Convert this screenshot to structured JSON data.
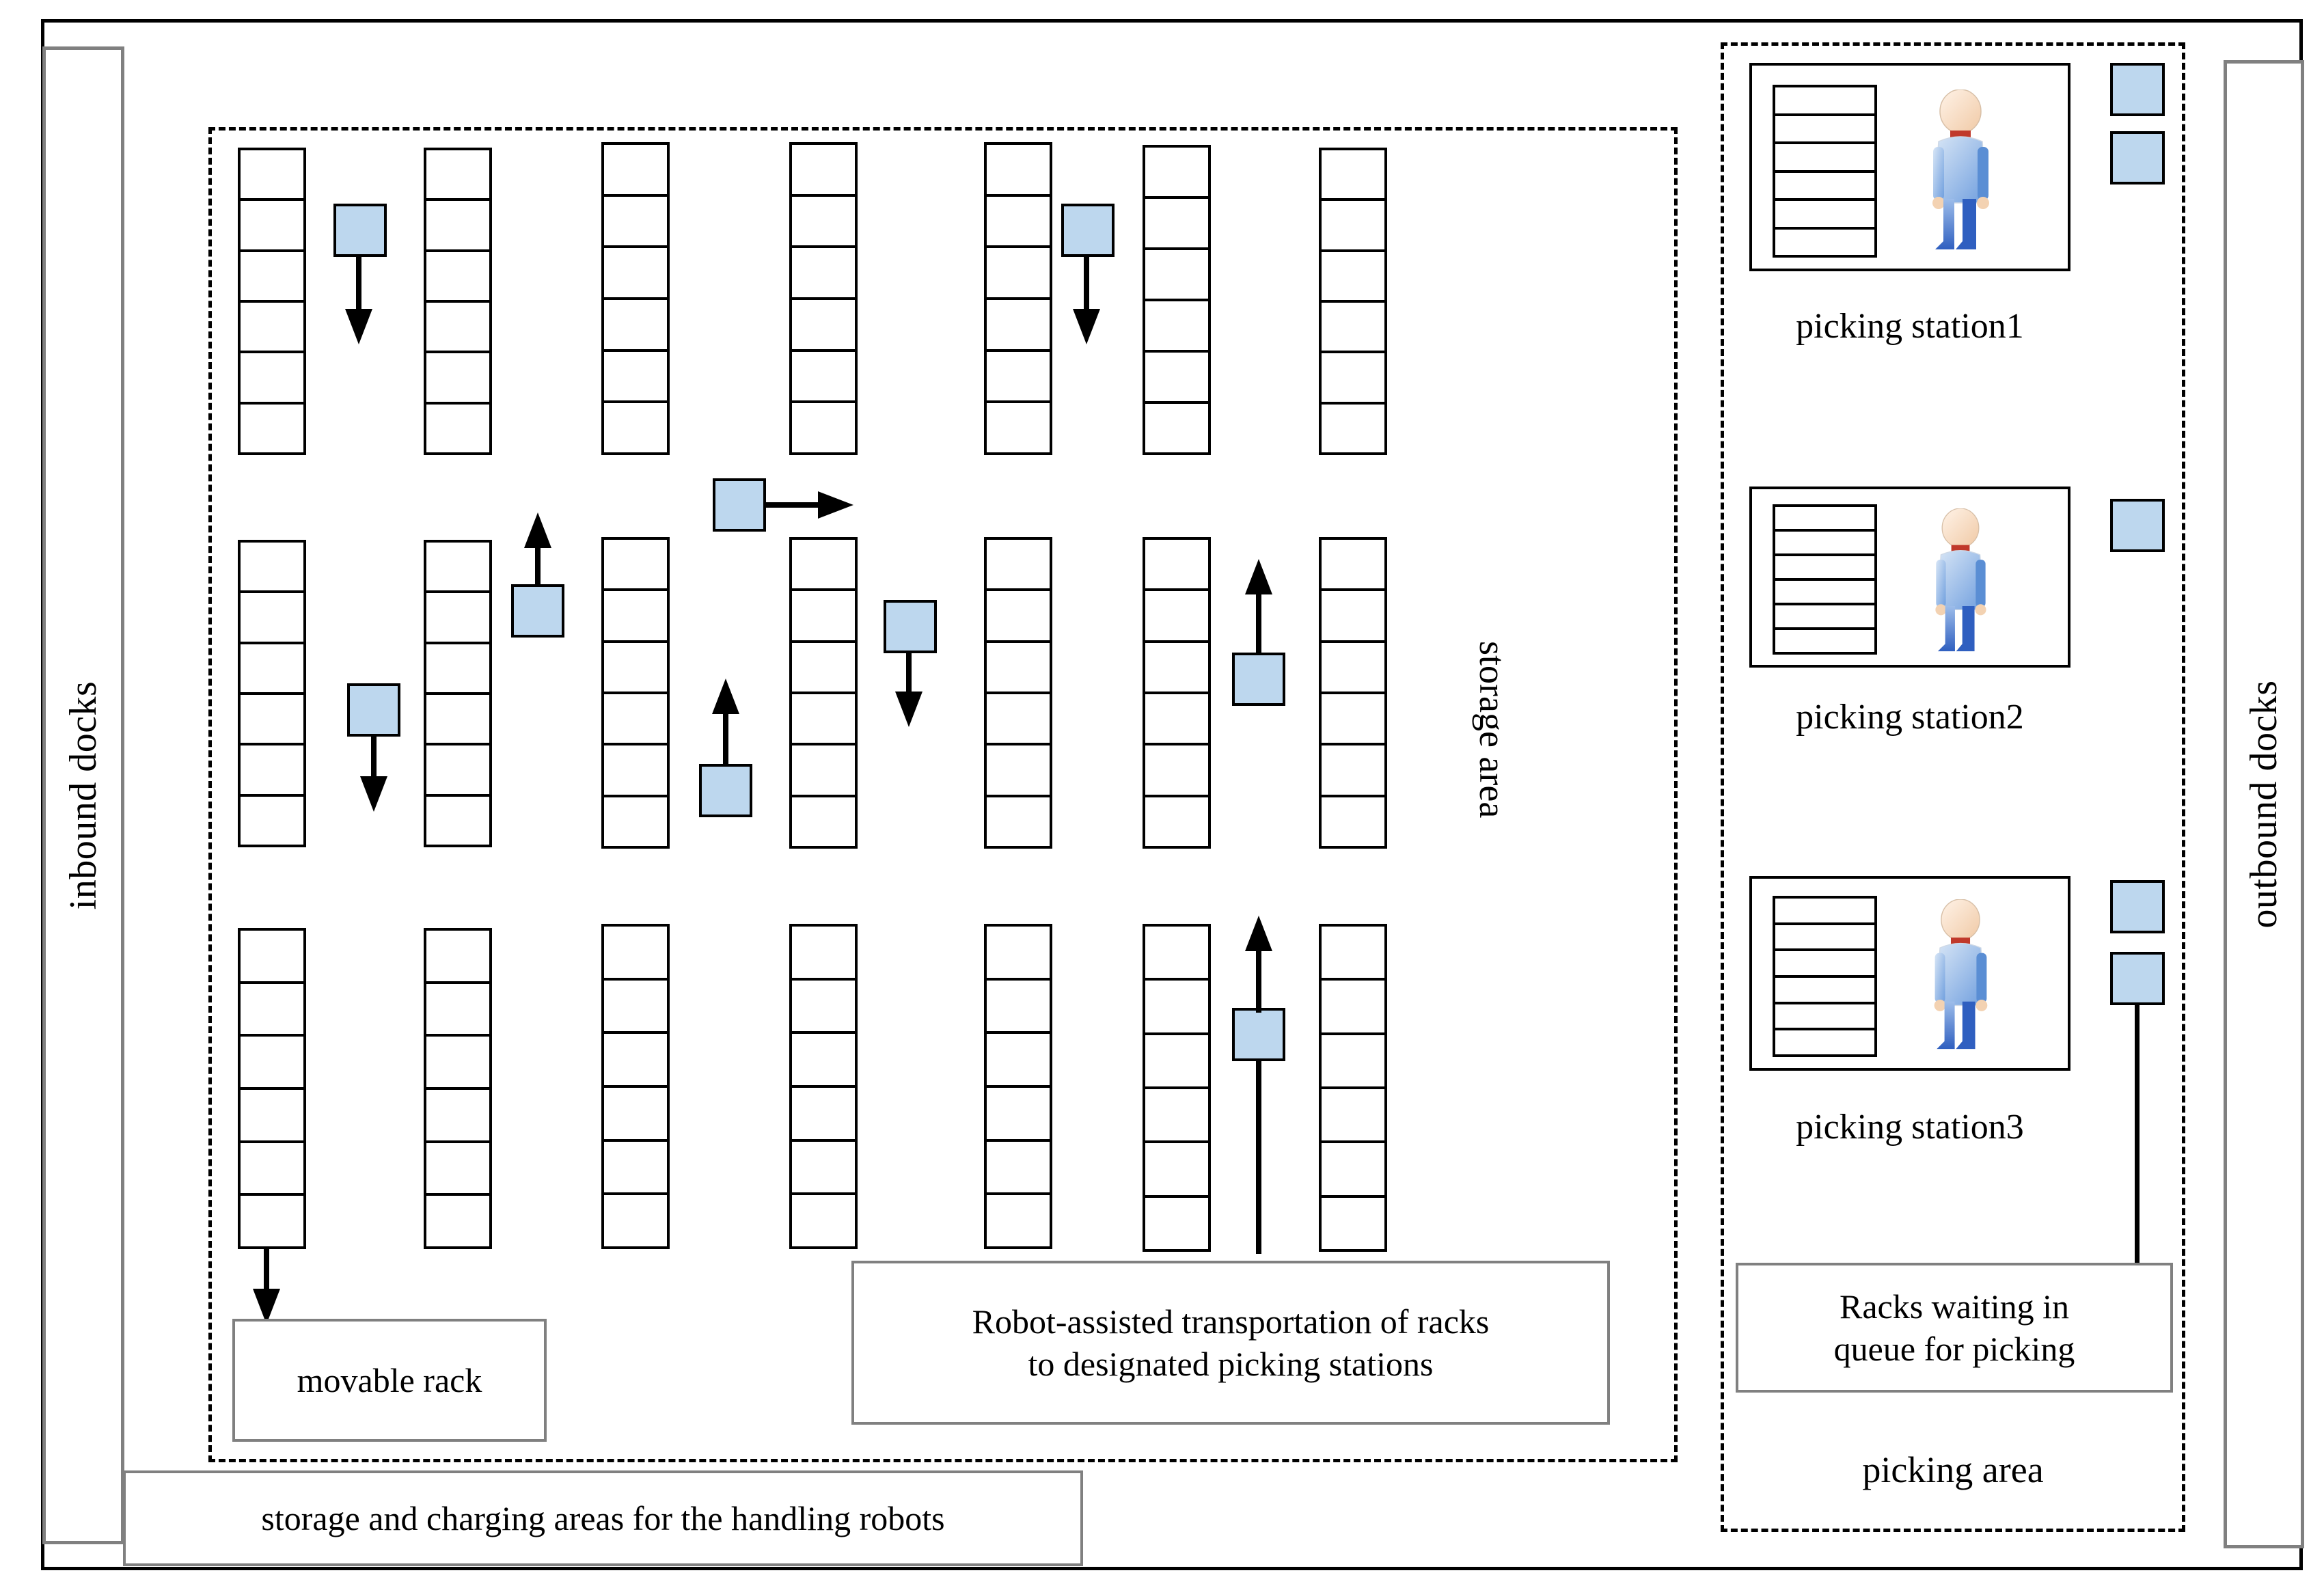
{
  "diagram": {
    "title_text_present": false,
    "areas": {
      "inbound_docks_label": "inbound  docks",
      "outbound_docks_label": "outbound docks",
      "storage_area_label": "storage area",
      "picking_area_label": "picking area"
    },
    "callouts": {
      "movable_rack": "movable rack",
      "robot_transport_line1": "Robot-assisted transportation of racks",
      "robot_transport_line2": "to designated picking stations",
      "charging_areas": "storage and charging areas for the handling robots",
      "racks_queue_line1": "Racks waiting in",
      "racks_queue_line2": "queue for picking"
    },
    "picking_stations": [
      {
        "label": "picking station1",
        "robot_count": 2
      },
      {
        "label": "picking station2",
        "robot_count": 1
      },
      {
        "label": "picking station3",
        "robot_count": 2
      }
    ],
    "colors": {
      "robot_fill": "#bdd7ee",
      "robot_stroke": "#000000",
      "frame_stroke": "#000000",
      "dock_stroke": "#808080",
      "callout_stroke": "#808080",
      "dashed_stroke": "#000000",
      "background": "#ffffff"
    },
    "storage_rows": [
      {
        "row": 1,
        "rack_count": 7,
        "cells_per_rack": 6
      },
      {
        "row": 2,
        "rack_count": 7,
        "cells_per_rack": 6
      },
      {
        "row": 3,
        "rack_count": 7,
        "cells_per_rack": 6
      }
    ],
    "robots_in_storage": [
      {
        "id": "r1",
        "row": 1,
        "direction": "down"
      },
      {
        "id": "r2",
        "row": 1,
        "direction": "down"
      },
      {
        "id": "r3",
        "row": "between-1-2",
        "direction": "right"
      },
      {
        "id": "r4",
        "row": 2,
        "direction": "up"
      },
      {
        "id": "r5",
        "row": 2,
        "direction": "down"
      },
      {
        "id": "r6",
        "row": 2,
        "direction": "down"
      },
      {
        "id": "r7",
        "row": 2,
        "direction": "up"
      },
      {
        "id": "r8",
        "row": 2,
        "direction": "up"
      },
      {
        "id": "r9",
        "row": 3,
        "direction": "up"
      }
    ]
  }
}
